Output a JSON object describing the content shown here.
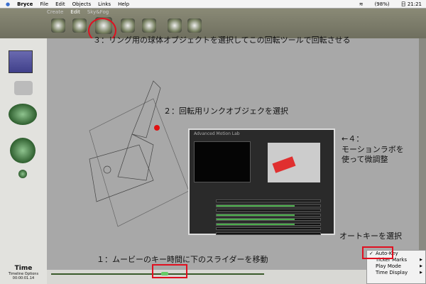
{
  "menubar": {
    "items": [
      "Bryce",
      "File",
      "Edit",
      "Objects",
      "Links",
      "Help"
    ],
    "battery": "(98%)",
    "clock": "日 21:21"
  },
  "toolbar": {
    "tabs": [
      "Create",
      "Edit",
      "Sky&Fog"
    ]
  },
  "annotations": {
    "step3": "３：リング用の球体オブジェクトを選択してこの回転ツールで回転させる",
    "step2": "２：回転用リンクオブジェクを選択",
    "step4a": "←４：",
    "step4b": "モーションラボを",
    "step4c": "使って微調整",
    "autokey": "オートキーを選択",
    "step1": "１：ムービーのキー時間に下のスライダーを移動"
  },
  "motion_lab": {
    "title": "Advanced Motion Lab",
    "tracks": [
      0,
      0.75,
      0,
      0.75,
      0.75,
      0.75,
      0,
      0
    ]
  },
  "popup": {
    "items": [
      {
        "label": "Auto-Key",
        "checked": true
      },
      {
        "label": "Ticker Marks"
      },
      {
        "label": "Play Mode"
      },
      {
        "label": "Time Display"
      }
    ]
  },
  "time": {
    "title": "Time",
    "options": "Timeline Options",
    "value": "00:00:01.14"
  },
  "timeline": {
    "position": 0.55
  }
}
